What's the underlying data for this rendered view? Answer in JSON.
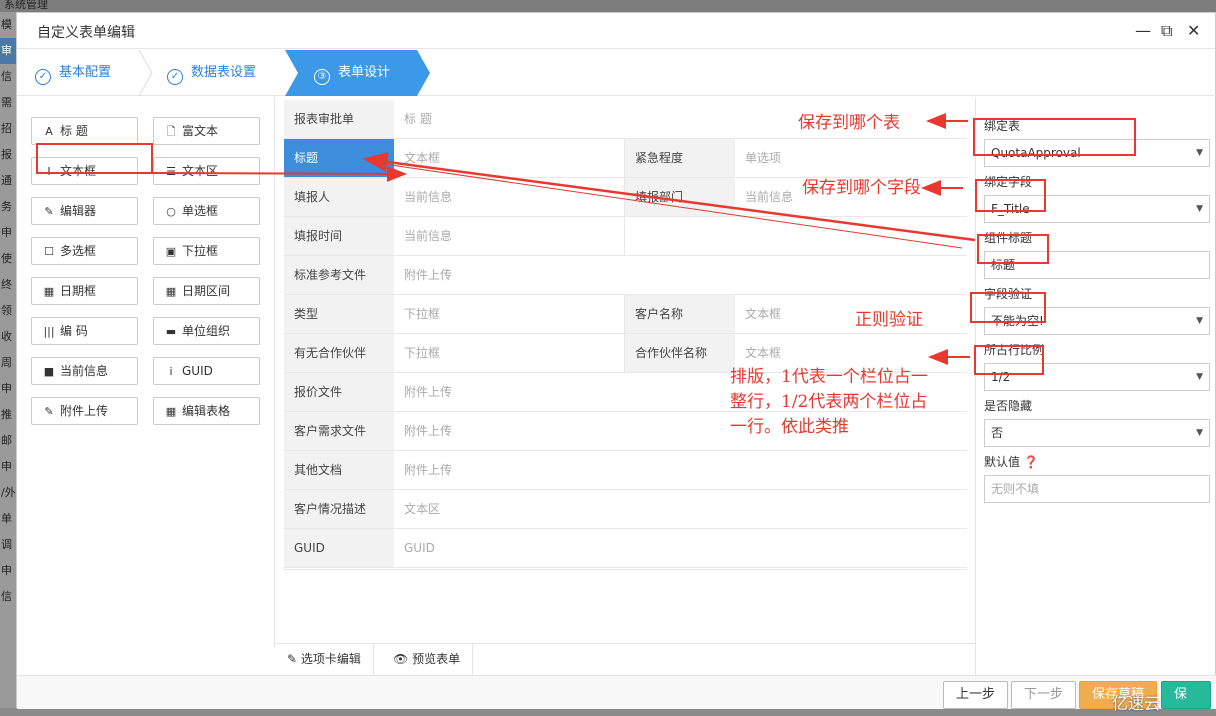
{
  "background": {
    "top_text": "系统管理",
    "left_items": [
      "模",
      "审",
      "信",
      "需",
      "招",
      "报",
      "通",
      "务",
      "申",
      "使",
      "终",
      "领",
      "收",
      "周",
      "申",
      "推",
      "邮",
      "申",
      "/外",
      "单",
      "调",
      "申",
      "信"
    ]
  },
  "dialog": {
    "title": "自定义表单编辑",
    "controls": {
      "minimize": "—",
      "maximize": "⧉",
      "close": "✕"
    }
  },
  "steps": [
    {
      "label": "基本配置",
      "icon": "check-circle-icon"
    },
    {
      "label": "数据表设置",
      "icon": "check-circle-icon"
    },
    {
      "label": "表单设计",
      "icon": "③"
    }
  ],
  "toolbox": [
    {
      "label": "标 题",
      "icon": "A"
    },
    {
      "label": "富文本",
      "icon": "🗋"
    },
    {
      "label": "文本框",
      "icon": "I"
    },
    {
      "label": "文本区",
      "icon": "☰"
    },
    {
      "label": "编辑器",
      "icon": "✎"
    },
    {
      "label": "单选框",
      "icon": "○"
    },
    {
      "label": "多选框",
      "icon": "☐"
    },
    {
      "label": "下拉框",
      "icon": "▣"
    },
    {
      "label": "日期框",
      "icon": "▦"
    },
    {
      "label": "日期区间",
      "icon": "▦"
    },
    {
      "label": "编 码",
      "icon": "|||"
    },
    {
      "label": "单位组织",
      "icon": "▬"
    },
    {
      "label": "当前信息",
      "icon": "■"
    },
    {
      "label": "GUID",
      "icon": "i"
    },
    {
      "label": "附件上传",
      "icon": "✎"
    },
    {
      "label": "编辑表格",
      "icon": "▦"
    }
  ],
  "form_rows": [
    {
      "cells": [
        {
          "label": "报表审批单",
          "value": "标 题"
        }
      ]
    },
    {
      "cells": [
        {
          "label": "标题",
          "value": "文本框"
        },
        {
          "label": "紧急程度",
          "value": "单选项"
        }
      ]
    },
    {
      "cells": [
        {
          "label": "填报人",
          "value": "当前信息"
        },
        {
          "label": "填报部门",
          "value": "当前信息"
        }
      ]
    },
    {
      "cells": [
        {
          "label": "填报时间",
          "value": "当前信息"
        },
        {
          "label": "",
          "value": ""
        }
      ]
    },
    {
      "cells": [
        {
          "label": "标准参考文件",
          "value": "附件上传"
        }
      ]
    },
    {
      "cells": [
        {
          "label": "类型",
          "value": "下拉框"
        },
        {
          "label": "客户名称",
          "value": "文本框"
        }
      ]
    },
    {
      "cells": [
        {
          "label": "有无合作伙伴",
          "value": "下拉框"
        },
        {
          "label": "合作伙伴名称",
          "value": "文本框"
        }
      ]
    },
    {
      "cells": [
        {
          "label": "报价文件",
          "value": "附件上传"
        }
      ]
    },
    {
      "cells": [
        {
          "label": "客户需求文件",
          "value": "附件上传"
        }
      ]
    },
    {
      "cells": [
        {
          "label": "其他文档",
          "value": "附件上传"
        }
      ]
    },
    {
      "cells": [
        {
          "label": "客户情况描述",
          "value": "文本区"
        }
      ]
    },
    {
      "cells": [
        {
          "label": "GUID",
          "value": "GUID"
        }
      ]
    }
  ],
  "bottom_tabs": {
    "tab_edit": "选项卡编辑",
    "preview": "预览表单"
  },
  "props": {
    "bind_table_label": "绑定表",
    "bind_table_value": "QuotaApproval",
    "bind_field_label": "绑定字段",
    "bind_field_value": "F_Title",
    "comp_title_label": "组件标题",
    "comp_title_value": "标题",
    "validation_label": "字段验证",
    "validation_value": "不能为空!",
    "ratio_label": "所占行比例",
    "ratio_value": "1/2",
    "hidden_label": "是否隐藏",
    "hidden_value": "否",
    "default_label": "默认值",
    "default_placeholder": "无则不填"
  },
  "footer": {
    "prev": "上一步",
    "next": "下一步",
    "save_draft": "保存草稿",
    "save": "保存"
  },
  "annotations": {
    "save_table": "保存到哪个表",
    "save_field": "保存到哪个字段",
    "regex": "正则验证",
    "layout_1": "排版，1代表一个栏位占一",
    "layout_2": "整行，1/2代表两个栏位占",
    "layout_3": "一行。依此类推"
  },
  "watermark": "亿速云",
  "colors": {
    "accent": "#3c99e8",
    "annotation": "#e8382f",
    "save_draft": "#f0ad4e",
    "save": "#26b99a"
  }
}
